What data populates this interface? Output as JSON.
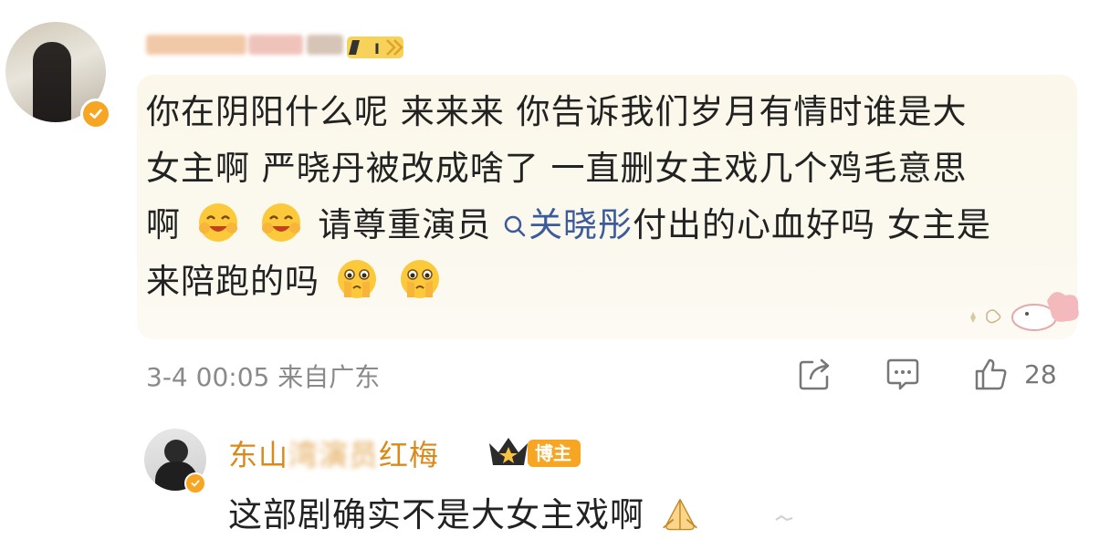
{
  "comment": {
    "author_display": "",
    "line1": "你在阴阳什么呢 来来来 你告诉我们岁月有情时谁是大",
    "line2": "女主啊 严晓丹被改成啥了 一直删女主戏几个鸡毛意思",
    "line3_start": "啊",
    "line3_mid": "请尊重演员",
    "topic": "关晓彤",
    "line3_end": "付出的心血好吗 女主是",
    "line4": "来陪跑的吗",
    "meta": "3-4 00:05 来自广东",
    "like_count": "28",
    "icons": [
      "share-icon",
      "comment-icon",
      "like-icon"
    ]
  },
  "reply": {
    "name_visible_start": "东山",
    "name_blurred": "湾演员",
    "name_visible_end": "红梅",
    "badge": "博主",
    "text": "这部剧确实不是大女主戏啊"
  },
  "colors": {
    "accent_orange": "#f6a623",
    "reply_name": "#d98a1a",
    "topic_link": "#3b5b9a",
    "meta_gray": "#8a8a8a",
    "card_bg": "#fbf7ea"
  }
}
